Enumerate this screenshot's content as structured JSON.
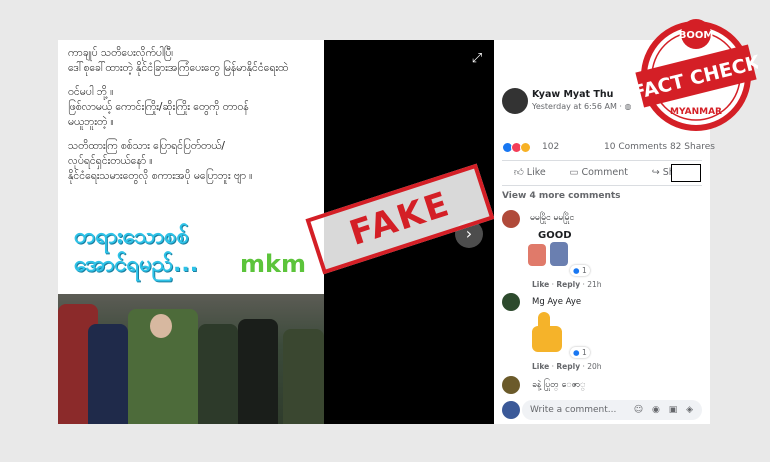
{
  "post": {
    "lines": [
      "ကာချုပ် သတိပေးလိုက်ပါပြီ၊\nဒေါ်စုခေါ်ထားတဲ့ နိုင်ငံခြားအကြံပေးတွေ မြန်မာနိုင်ငံရေးထဲ",
      "ဝင်မပါ ဘို့ ။\nဖြစ်လာမယ့် ကောင်းကြိုး/ဆိုးကြိုး တွေကို တာဝန်\nမယူဘူးတဲ့ ။",
      "သတိထားကြ စစ်သား ပြောရင်ပြတ်တယ်/\nလုပ်ရင်ရှင်းတယ်နော် ။\nနိုင်ငံရေးသမားတွေလို        စကားအပို မပြောဘူး ဗျာ ။"
    ],
    "big_text_1": "တရားသောစစ်",
    "big_text_2": "အောင်ရမည်...",
    "mkm": "mkm",
    "stamp": "FAKE"
  },
  "side": {
    "author": "Kyaw Myat Thu",
    "time": "Yesterday at 6:56 AM · ",
    "reaction_count": "102",
    "comments_shares": "10 Comments  82 Shares",
    "like": "Like",
    "comment": "Comment",
    "share": "Share",
    "view_more": "View 4 more comments",
    "c1_name": "မမမြိုင မမမြိုင",
    "c1_sticker": "GOOD",
    "c1_react": "1",
    "c1_meta_like": "Like",
    "c1_meta_reply": "Reply",
    "c1_meta_time": "· 21h",
    "c2_name": "Mg Aye Aye",
    "c2_react": "1",
    "c2_meta_like": "Like",
    "c2_meta_reply": "Reply",
    "c2_meta_time": "· 20h",
    "c3_name": "ခနဲ့ ပြုတ္ ေဇာ္",
    "write_placeholder": "Write a comment...",
    "write_icons": "☺ ◉ ▣ ◈"
  },
  "badge": {
    "top": "BOOM",
    "main1": "FACT",
    "main2": "CHECK",
    "bottom": "MYANMAR"
  },
  "colors": {
    "accent": "#d41f26",
    "fb_blue": "#1877f2"
  }
}
